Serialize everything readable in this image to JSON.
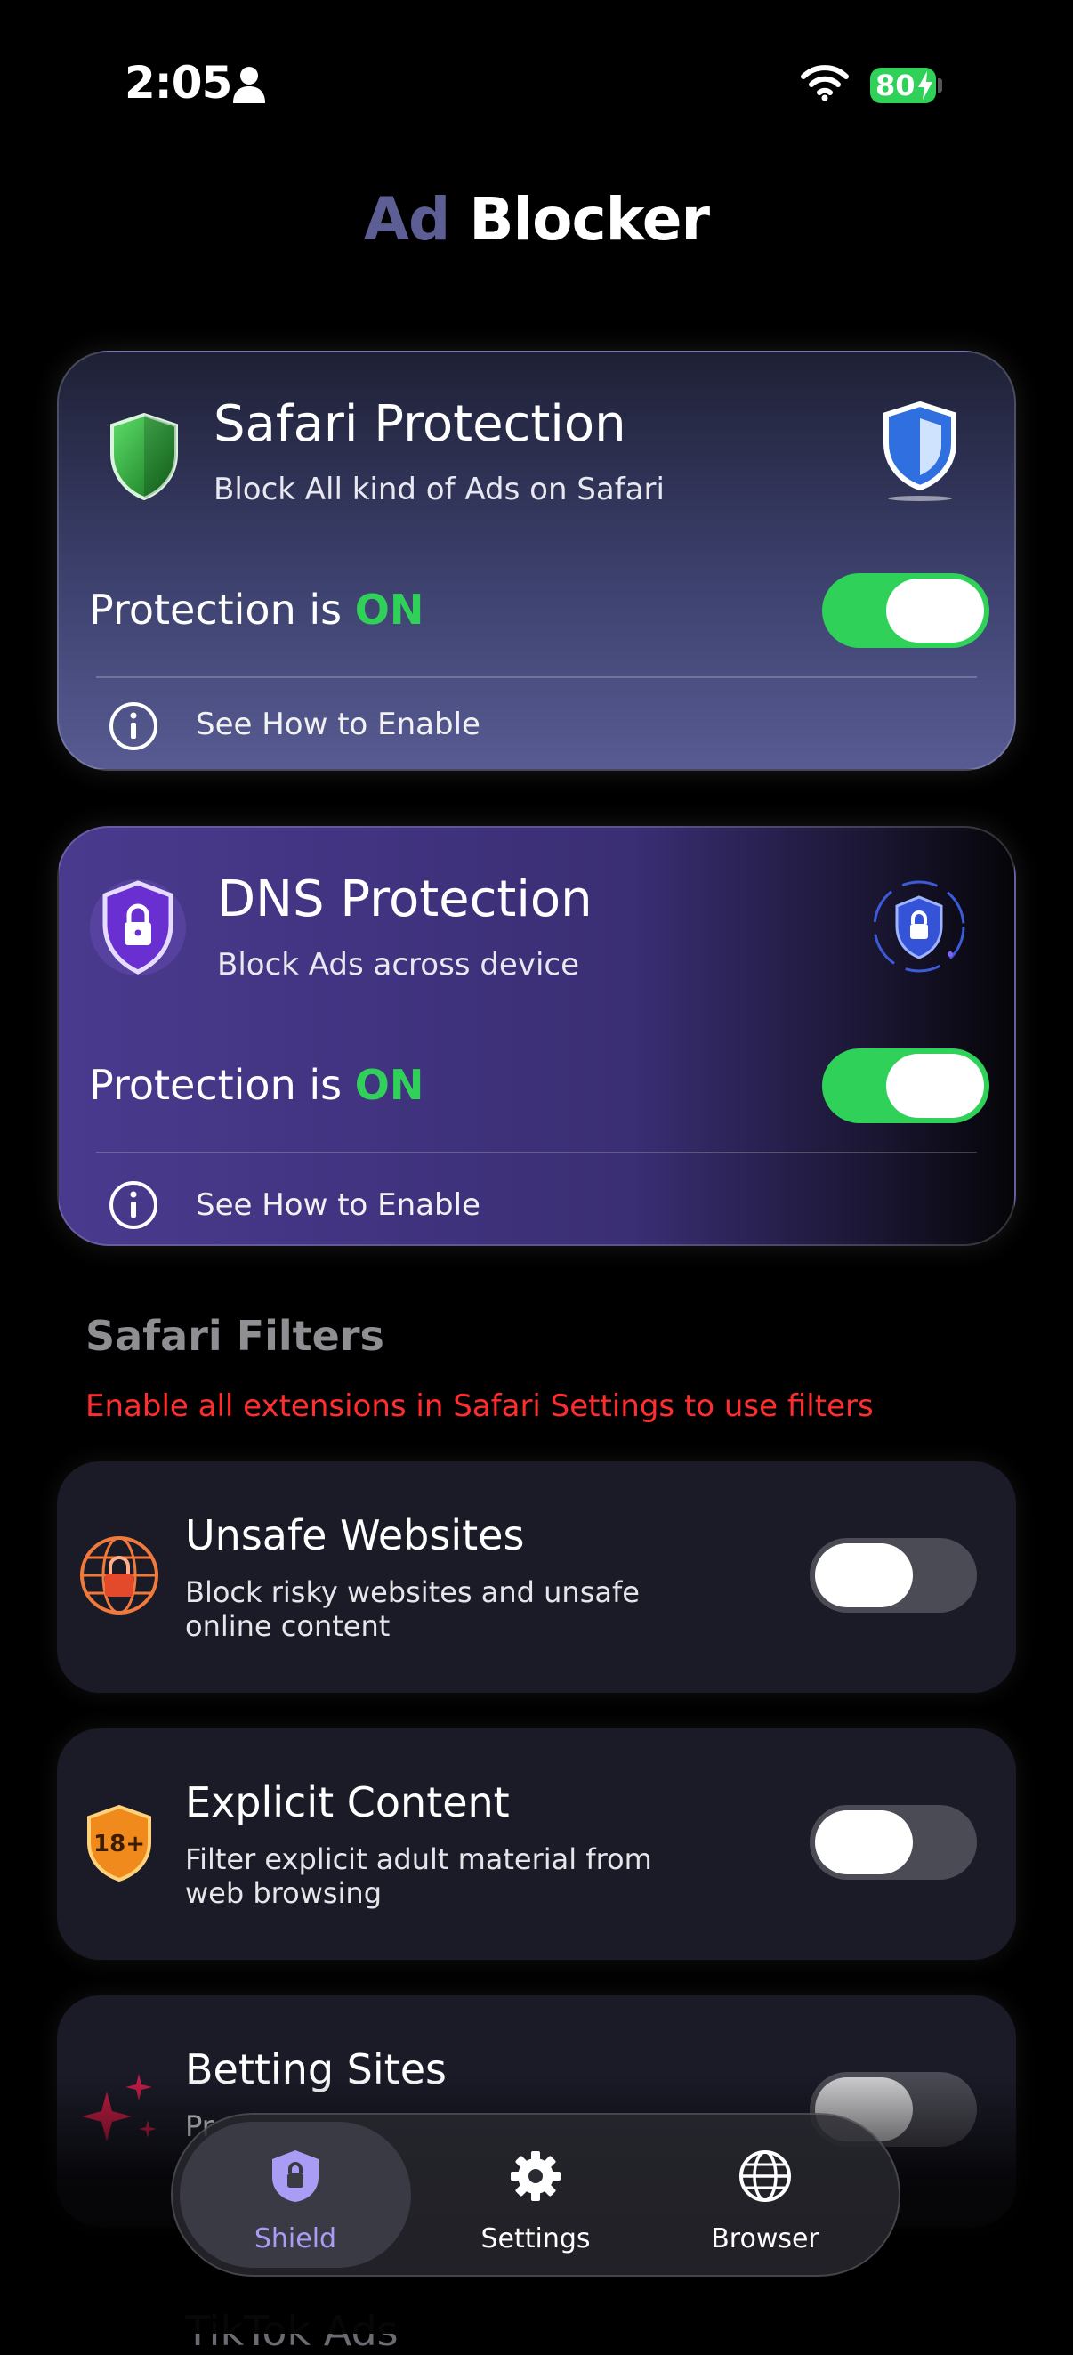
{
  "status_bar": {
    "time": "2:05",
    "battery": "80"
  },
  "header": {
    "title_part1": "Ad",
    "title_part2": "Blocker"
  },
  "safari_card": {
    "title": "Safari Protection",
    "subtitle": "Block All kind of Ads on Safari",
    "status_prefix": "Protection is ",
    "status_value": "ON",
    "toggle_on": true,
    "help_link": "See How to Enable"
  },
  "dns_card": {
    "title": "DNS Protection",
    "subtitle": "Block Ads across device",
    "status_prefix": "Protection is ",
    "status_value": "ON",
    "toggle_on": true,
    "help_link": "See How to Enable"
  },
  "filters": {
    "section_title": "Safari Filters",
    "warning": "Enable all extensions in Safari Settings to use filters",
    "items": [
      {
        "title": "Unsafe Websites",
        "subtitle": "Block risky websites and unsafe online content",
        "enabled": false,
        "icon": "globe-lock-icon"
      },
      {
        "title": "Explicit Content",
        "subtitle": "Filter explicit adult material from web browsing",
        "enabled": false,
        "icon": "18-plus-badge-icon"
      },
      {
        "title": "Betting Sites",
        "subtitle": "Pr",
        "enabled": false,
        "icon": "sparkle-icon"
      },
      {
        "title": "TikTok Ads"
      }
    ]
  },
  "tab_bar": {
    "tabs": [
      {
        "label": "Shield",
        "icon": "shield-lock-icon",
        "active": true
      },
      {
        "label": "Settings",
        "icon": "gear-icon",
        "active": false
      },
      {
        "label": "Browser",
        "icon": "globe-icon",
        "active": false
      }
    ]
  },
  "colors": {
    "on_green": "#30d158",
    "warning_red": "#ff2d2d",
    "active_tab": "#a99cf5",
    "title_ad": "#5d5f94"
  }
}
